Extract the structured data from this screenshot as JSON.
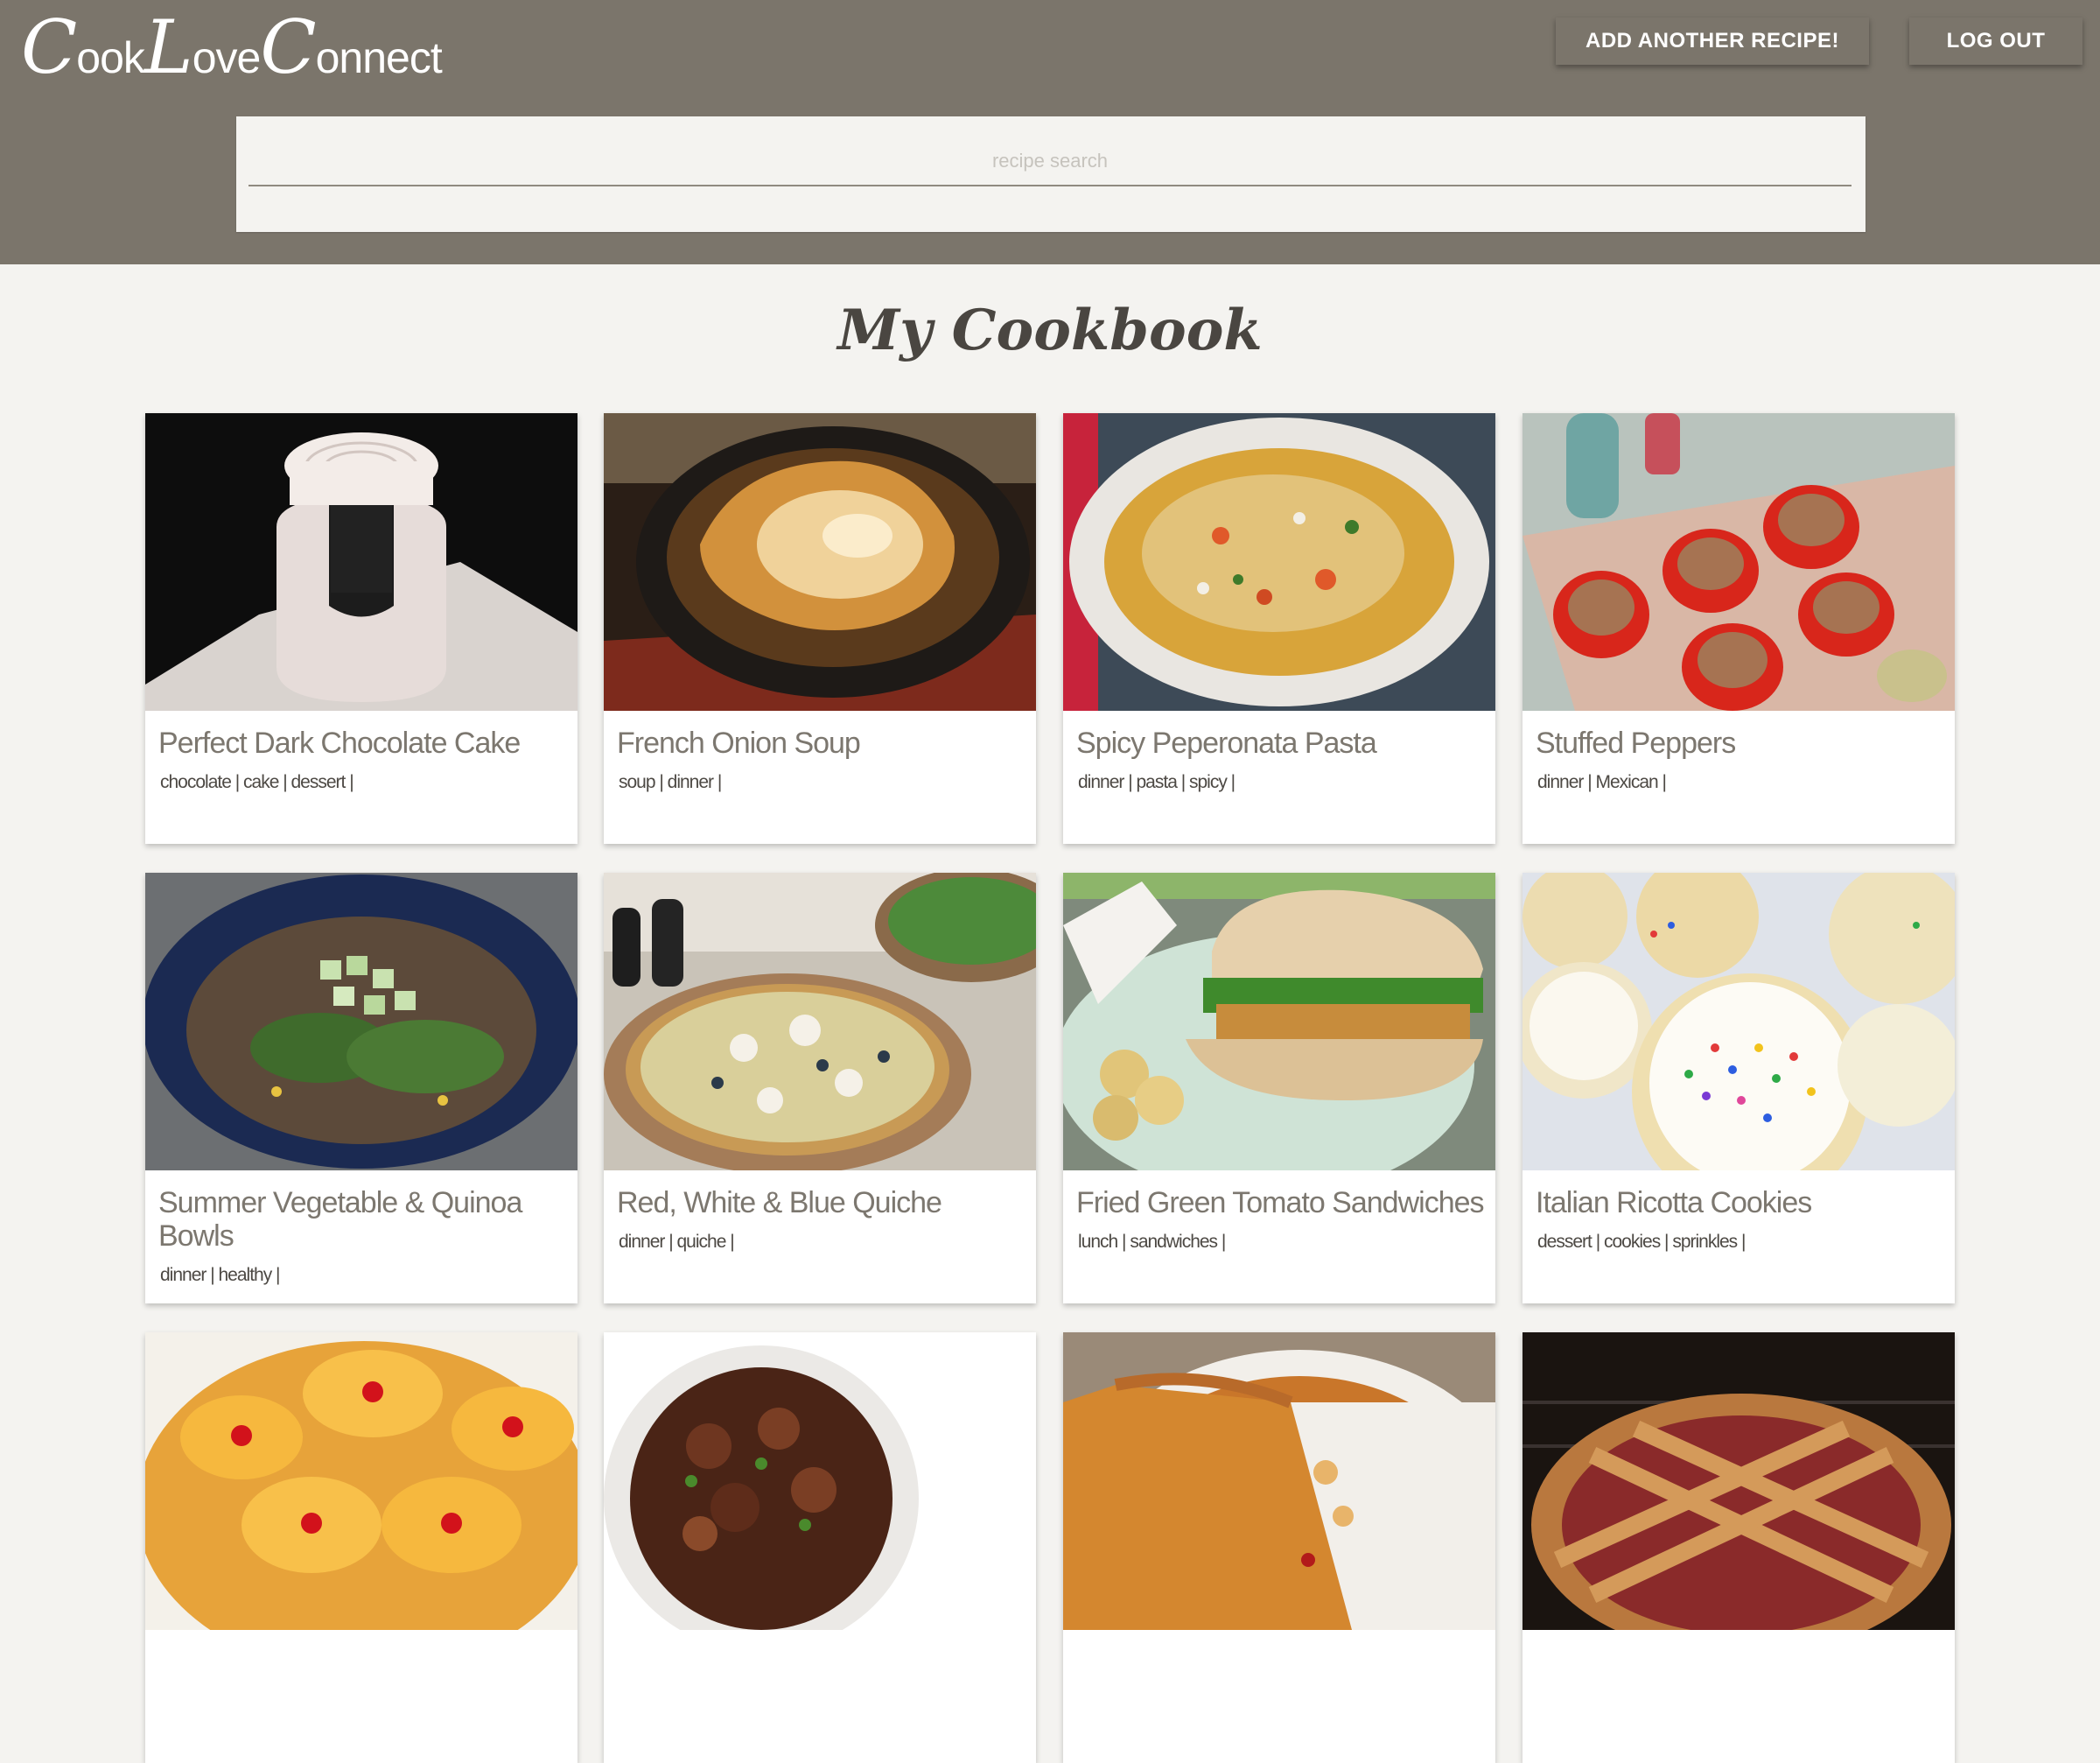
{
  "header": {
    "logo": {
      "c1": "C",
      "w1": "ook",
      "c2": "L",
      "w2": "ove",
      "c3": "C",
      "w3": "onnect"
    },
    "add_recipe_label": "ADD ANOTHER RECIPE!",
    "logout_label": "LOG OUT",
    "search_placeholder": "recipe search"
  },
  "main": {
    "title": "My Cookbook",
    "recipes": [
      {
        "title": "Perfect Dark Chocolate Cake",
        "tags": "chocolate | cake | dessert |"
      },
      {
        "title": "French Onion Soup",
        "tags": "soup | dinner |"
      },
      {
        "title": "Spicy Peperonata Pasta",
        "tags": "dinner | pasta | spicy |"
      },
      {
        "title": "Stuffed Peppers",
        "tags": "dinner | Mexican |"
      },
      {
        "title": "Summer Vegetable & Quinoa Bowls",
        "tags": "dinner | healthy |"
      },
      {
        "title": "Red, White & Blue Quiche",
        "tags": "dinner | quiche |"
      },
      {
        "title": "Fried Green Tomato Sandwiches",
        "tags": "lunch | sandwiches |"
      },
      {
        "title": "Italian Ricotta Cookies",
        "tags": "dessert | cookies | sprinkles |"
      },
      {
        "title": "",
        "tags": ""
      },
      {
        "title": "",
        "tags": ""
      },
      {
        "title": "",
        "tags": ""
      },
      {
        "title": "",
        "tags": ""
      }
    ]
  },
  "colors": {
    "header_bg": "#7b756b",
    "page_bg": "#f4f3f0",
    "card_title": "#7c776f"
  }
}
